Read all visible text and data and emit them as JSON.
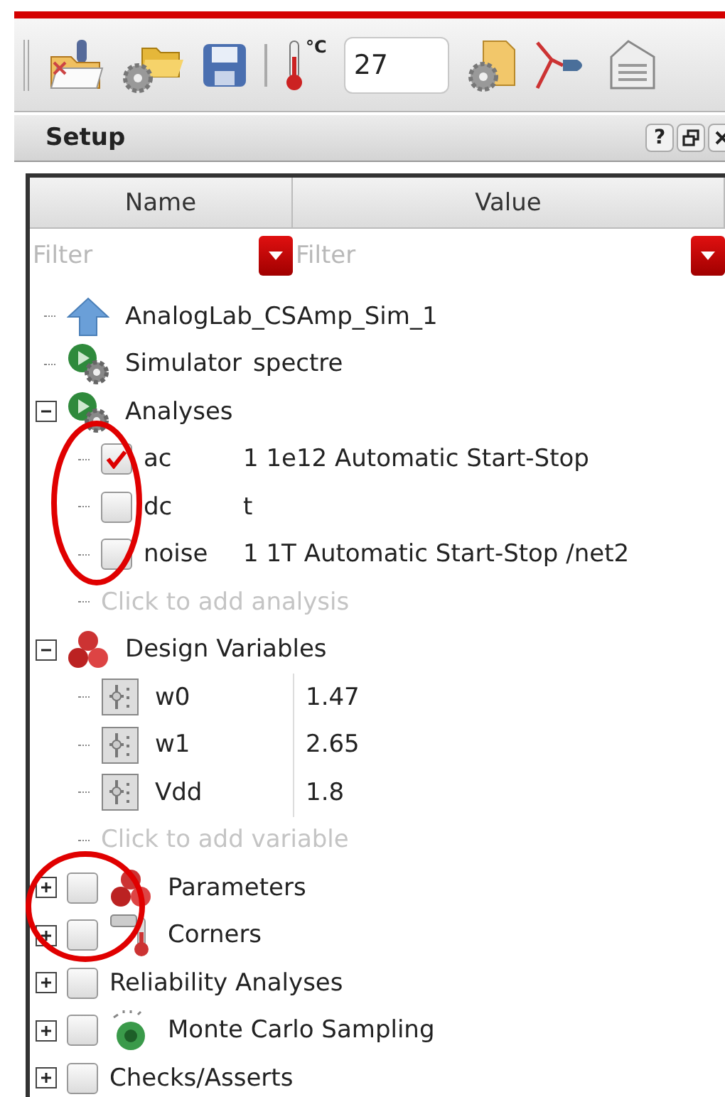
{
  "toolbar": {
    "temperature_unit": "°C",
    "temperature": "27"
  },
  "panel": {
    "title": "Setup",
    "help": "?"
  },
  "columns": [
    "Name",
    "Value"
  ],
  "filters": [
    {
      "placeholder": "Filter"
    },
    {
      "placeholder": "Filter"
    }
  ],
  "tree": [
    {
      "kind": "item",
      "name": "AnalogLab_CSAmp_Sim_1"
    },
    {
      "kind": "item",
      "name": "Simulator",
      "value": "spectre"
    },
    {
      "kind": "item",
      "name": "Analyses",
      "expanded": true,
      "children": [
        {
          "kind": "item",
          "name": "ac",
          "value": "1 1e12 Automatic Start-Stop",
          "checked": true
        },
        {
          "kind": "item",
          "name": "dc",
          "value": "t",
          "checked": false
        },
        {
          "kind": "item",
          "name": "noise",
          "value": "1 1T Automatic Start-Stop /net2",
          "checked": false
        },
        {
          "kind": "add",
          "name": "Click to add analysis"
        }
      ]
    },
    {
      "kind": "item",
      "name": "Design Variables",
      "expanded": true,
      "children": [
        {
          "kind": "variable",
          "name": "w0",
          "value": "1.47"
        },
        {
          "kind": "variable",
          "name": "w1",
          "value": "2.65"
        },
        {
          "kind": "variable",
          "name": "Vdd",
          "value": "1.8"
        },
        {
          "kind": "add",
          "name": "Click to add variable"
        }
      ]
    },
    {
      "kind": "item",
      "name": "Parameters",
      "expanded": false,
      "checked": false
    },
    {
      "kind": "item",
      "name": "Corners",
      "expanded": false,
      "checked": false
    },
    {
      "kind": "item",
      "name": "Reliability Analyses",
      "expanded": false,
      "checked": false
    },
    {
      "kind": "item",
      "name": "Monte Carlo Sampling",
      "expanded": false,
      "checked": false
    },
    {
      "kind": "item",
      "name": "Checks/Asserts",
      "expanded": false,
      "checked": false
    }
  ],
  "annotations": [
    {
      "kind": "ellipse",
      "color": "#e00000"
    },
    {
      "kind": "ellipse",
      "color": "#e00000"
    }
  ]
}
